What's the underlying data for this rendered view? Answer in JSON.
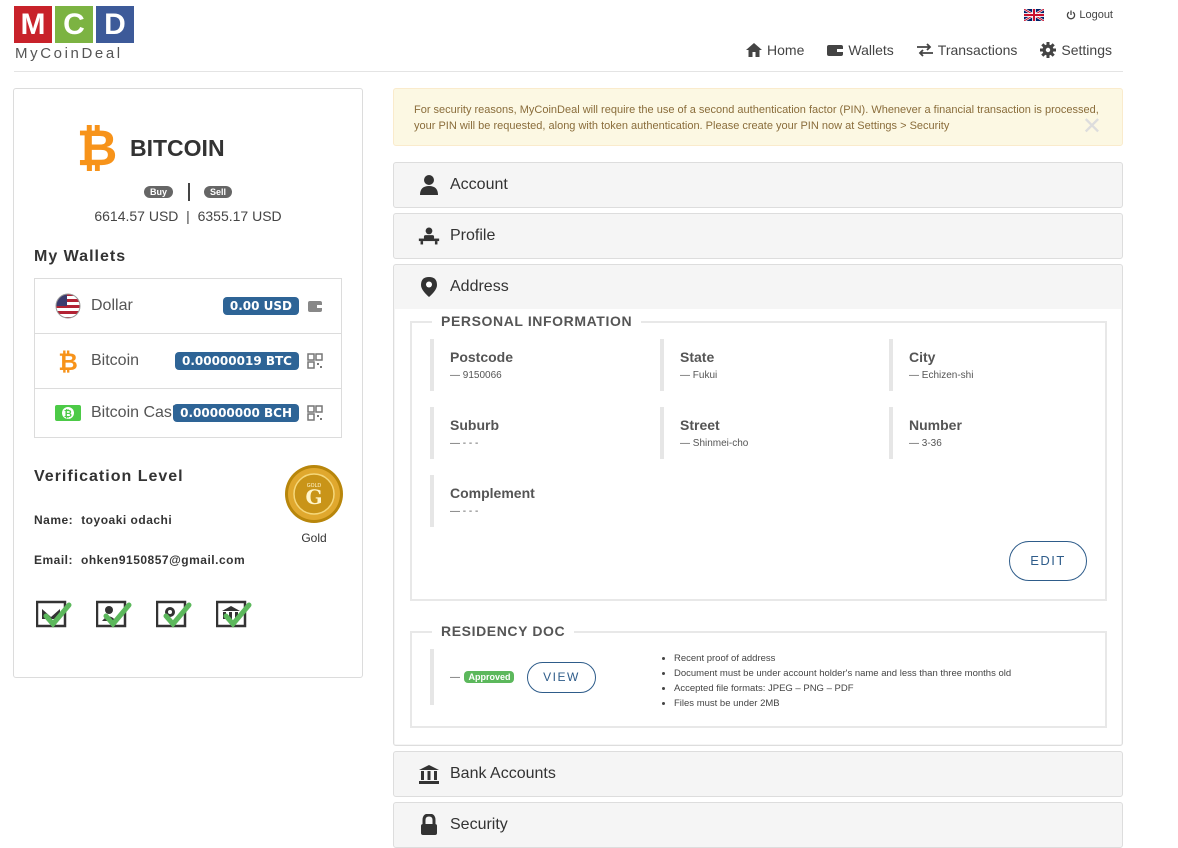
{
  "logo": {
    "letters": [
      "M",
      "C",
      "D"
    ],
    "colors": [
      "#c8222a",
      "#7cb342",
      "#3d5a99"
    ],
    "text": "MyCoinDeal"
  },
  "topbar": {
    "logout_label": "Logout",
    "language_icon": "uk-flag-icon"
  },
  "nav": [
    {
      "label": "Home",
      "icon": "home-icon"
    },
    {
      "label": "Wallets",
      "icon": "wallet-icon"
    },
    {
      "label": "Transactions",
      "icon": "exchange-icon"
    },
    {
      "label": "Settings",
      "icon": "gear-icon"
    }
  ],
  "coin": {
    "name": "BITCOIN",
    "buy_label": "Buy",
    "sell_label": "Sell",
    "prices": "6614.57 USD  |  6355.17 USD",
    "color": "#f7931a"
  },
  "wallets": {
    "title": "My Wallets",
    "items": [
      {
        "name": "Dollar",
        "balance": "0.00 USD"
      },
      {
        "name": "Bitcoin",
        "balance": "0.00000019 BTC"
      },
      {
        "name": "Bitcoin Cash",
        "balance": "0.00000000 BCH"
      }
    ]
  },
  "verification": {
    "title": "Verification Level",
    "name_label": "Name:",
    "name_value": "toyoaki odachi",
    "email_label": "Email:",
    "email_value": "ohken9150857@gmail.com",
    "level": "Gold",
    "medal_letter": "G",
    "medal_text": "GOLD"
  },
  "alert": {
    "text": "For security reasons, MyCoinDeal will require the use of a second authentication factor (PIN). Whenever a financial transaction is processed, your PIN will be requested, along with token authentication. Please create your PIN now at Settings > Security"
  },
  "panels": {
    "account": "Account",
    "profile": "Profile",
    "address": "Address",
    "bank": "Bank Accounts",
    "security": "Security"
  },
  "personal_info": {
    "legend": "PERSONAL INFORMATION",
    "fields": [
      {
        "label": "Postcode",
        "value": "— 9150066"
      },
      {
        "label": "State",
        "value": "— Fukui"
      },
      {
        "label": "City",
        "value": "— Echizen-shi"
      },
      {
        "label": "Suburb",
        "value": "— - - -"
      },
      {
        "label": "Street",
        "value": "— Shinmei-cho"
      },
      {
        "label": "Number",
        "value": "— 3-36"
      },
      {
        "label": "Complement",
        "value": "— - - -"
      }
    ],
    "edit_label": "EDIT"
  },
  "residency": {
    "legend": "RESIDENCY DOC",
    "dash": "—",
    "status": "Approved",
    "view_label": "VIEW",
    "requirements": [
      "Recent proof of address",
      "Document must be under account holder's name and less than three months old",
      "Accepted file formats: JPEG – PNG – PDF",
      "Files must be under 2MB"
    ]
  }
}
